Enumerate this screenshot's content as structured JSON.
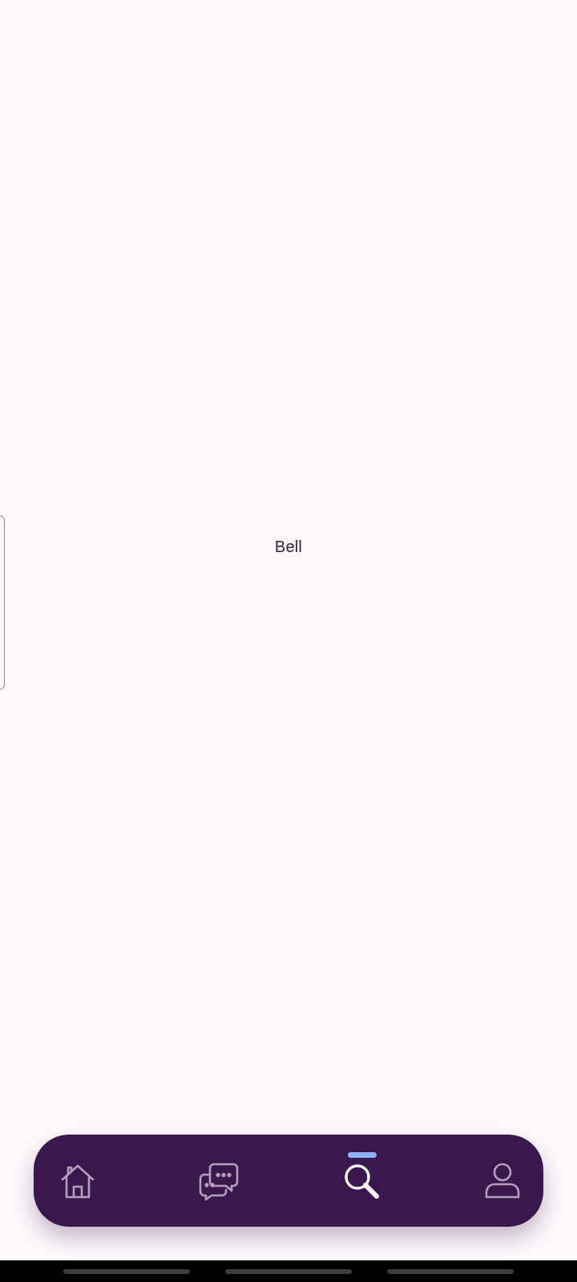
{
  "main": {
    "center_label": "Bell"
  },
  "bottom_nav": {
    "items": [
      {
        "icon": "home-icon",
        "active": false
      },
      {
        "icon": "chat-icon",
        "active": false
      },
      {
        "icon": "search-icon",
        "active": true
      },
      {
        "icon": "profile-icon",
        "active": false
      }
    ],
    "background": "#3A174C",
    "icon_color": "#B3A0BC",
    "active_icon_color": "#FFFFFF",
    "indicator_color": "#8FB2F7"
  },
  "theme": {
    "background": "#FDF8FC",
    "text_color": "#2A2530"
  }
}
